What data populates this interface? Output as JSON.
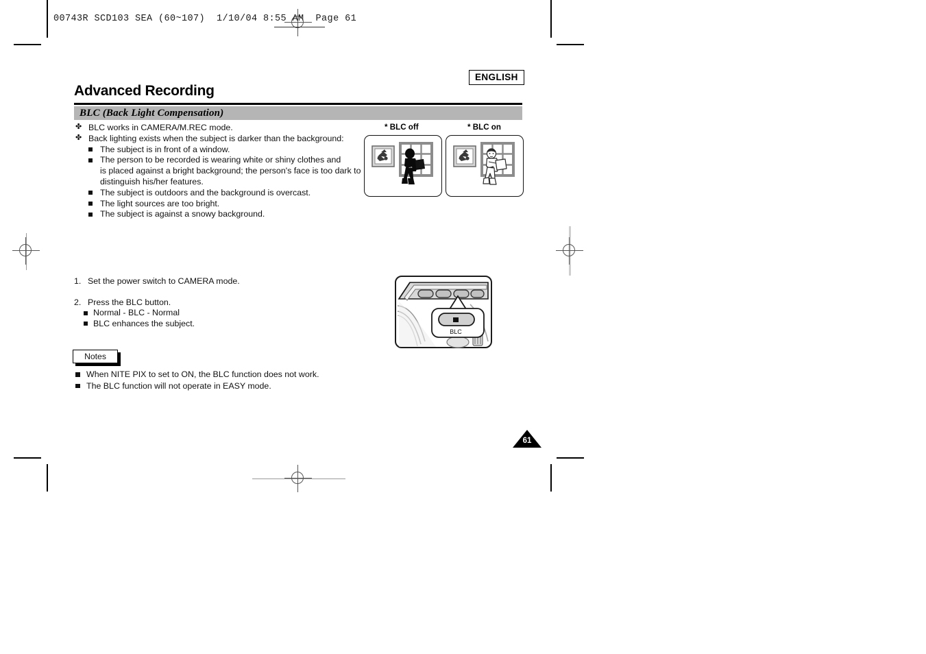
{
  "print_marks": {
    "file_header": "00743R SCD103 SEA (60~107)  1/10/04 8:55 AM  Page 61"
  },
  "header": {
    "language_badge": "ENGLISH",
    "page_title": "Advanced Recording",
    "section_title": "BLC (Back Light Compensation)"
  },
  "intro": {
    "bullets": [
      {
        "marker": "✤",
        "text": "BLC works in CAMERA/M.REC mode."
      },
      {
        "marker": "✤",
        "text": "Back lighting exists when the subject is darker than the background:"
      }
    ],
    "sub_bullets": [
      {
        "lines": [
          "The subject is in front of a window."
        ]
      },
      {
        "lines": [
          "The person to be recorded is wearing white or shiny clothes and",
          "is placed against a bright background; the person's face is too dark to",
          "distinguish his/her features."
        ]
      },
      {
        "lines": [
          "The subject is outdoors and the background is overcast."
        ]
      },
      {
        "lines": [
          "The light sources are too bright."
        ]
      },
      {
        "lines": [
          "The subject is against a snowy background."
        ]
      }
    ]
  },
  "illustrations": {
    "blc_off_caption": "* BLC off",
    "blc_on_caption": "* BLC on"
  },
  "steps": [
    {
      "number": "1.",
      "text": "Set the power switch to CAMERA mode."
    },
    {
      "number": "2.",
      "text": "Press the BLC button.",
      "sub_items": [
        "Normal - BLC - Normal",
        "BLC enhances the subject."
      ]
    }
  ],
  "camera_diagram": {
    "button_label": "BLC"
  },
  "notes": {
    "label": "Notes",
    "items": [
      "When NITE PIX to set to ON, the BLC function does not work.",
      "The BLC function will not operate in EASY mode."
    ]
  },
  "footer": {
    "page_number": "61"
  },
  "colors": {
    "section_bar": "#b5b5b5",
    "text": "#111111",
    "rule": "#000000"
  }
}
